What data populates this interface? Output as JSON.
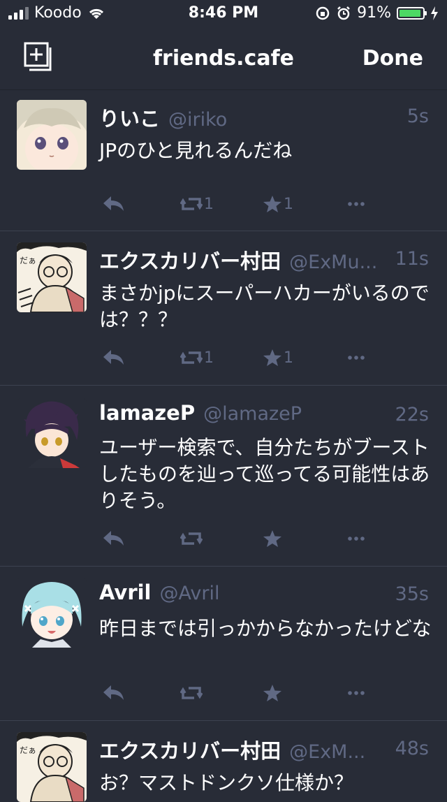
{
  "status_bar": {
    "carrier": "Koodo",
    "time": "8:46 PM",
    "battery": "91%"
  },
  "nav": {
    "title": "friends.cafe",
    "done_label": "Done"
  },
  "posts": [
    {
      "name": "りいこ",
      "handle": "@iriko",
      "time": "5s",
      "content": "JPのひと見れるんだね",
      "reblogs": "1",
      "favourites": "1"
    },
    {
      "name": "エクスカリバー村田",
      "handle": "@ExMu...",
      "time": "11s",
      "content": "まさかjpにスーパーハカーがいるのでは？？？",
      "reblogs": "1",
      "favourites": "1"
    },
    {
      "name": "lamazeP",
      "handle": "@lamazeP",
      "time": "22s",
      "content": "ユーザー検索で、自分たちがブーストしたものを辿って巡ってる可能性はありそう。",
      "reblogs": "",
      "favourites": ""
    },
    {
      "name": "Avril",
      "handle": "@Avril",
      "time": "35s",
      "content": "昨日までは引っかからなかったけどな",
      "reblogs": "",
      "favourites": ""
    },
    {
      "name": "エクスカリバー村田",
      "handle": "@ExM...",
      "time": "48s",
      "content": "お？マストドンクソ仕様か？",
      "reblogs": "",
      "favourites": ""
    }
  ],
  "colors": {
    "background": "#282c37",
    "muted": "#606984",
    "battery": "#4cd964"
  },
  "icons": [
    "compose-icon",
    "reply-icon",
    "boost-icon",
    "favourite-icon",
    "more-icon"
  ]
}
